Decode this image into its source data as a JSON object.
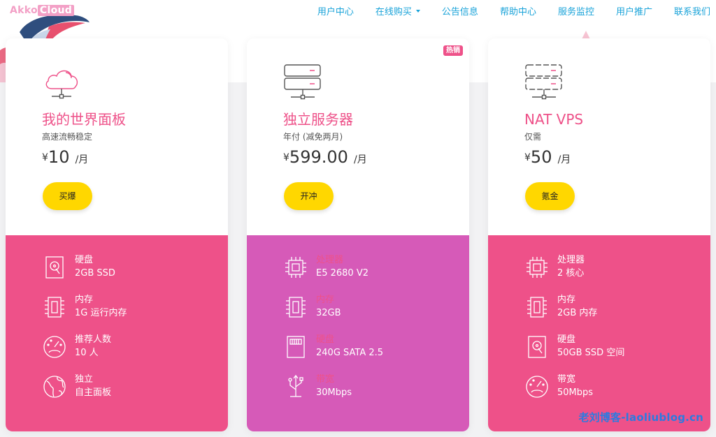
{
  "colors": {
    "accent": "#ee5189",
    "purple": "#d65ab8",
    "nav": "#1aa3d9",
    "button": "#ffd700"
  },
  "logo": {
    "part1": "Akko",
    "part2": "Cloud"
  },
  "nav": {
    "items": [
      "用户中心",
      "在线购买",
      "公告信息",
      "帮助中心",
      "服务监控",
      "用户推广",
      "联系我们"
    ]
  },
  "plans": [
    {
      "icon": "cloud-icon",
      "name": "我的世界面板",
      "subtitle": "高速流畅稳定",
      "currency": "¥",
      "price": "10",
      "unit": "/月",
      "button": "买爆",
      "features": [
        {
          "icon": "disk-icon",
          "label": "硬盘",
          "value": "2GB SSD"
        },
        {
          "icon": "memory-icon",
          "label": "内存",
          "value": "1G 运行内存"
        },
        {
          "icon": "gauge-icon",
          "label": "推荐人数",
          "value": "10 人"
        },
        {
          "icon": "globe-icon",
          "label": "独立",
          "value": "自主面板"
        }
      ]
    },
    {
      "icon": "server-icon",
      "badge": "热销",
      "name": "独立服务器",
      "subtitle": "年付 (减免两月)",
      "currency": "¥",
      "price": "599.00",
      "unit": "/月",
      "button": "开冲",
      "features": [
        {
          "icon": "cpu-icon",
          "label": "处理器",
          "value": "E5 2680 V2"
        },
        {
          "icon": "memory-icon",
          "label": "内存",
          "value": "32GB"
        },
        {
          "icon": "sd-card-icon",
          "label": "硬盘",
          "value": "240G SATA 2.5"
        },
        {
          "icon": "usb-icon",
          "label": "带宽",
          "value": "30Mbps"
        }
      ]
    },
    {
      "icon": "server-icon",
      "name": "NAT VPS",
      "subtitle": "仅需",
      "currency": "¥",
      "price": "50",
      "unit": "/月",
      "button": "氪金",
      "features": [
        {
          "icon": "cpu-icon",
          "label": "处理器",
          "value": "2 核心"
        },
        {
          "icon": "memory-icon",
          "label": "内存",
          "value": "2GB 内存"
        },
        {
          "icon": "disk-icon",
          "label": "硬盘",
          "value": "50GB SSD 空间"
        },
        {
          "icon": "gauge-icon",
          "label": "带宽",
          "value": "50Mbps"
        }
      ]
    }
  ],
  "watermark": "老刘博客-laoliublog.cn"
}
